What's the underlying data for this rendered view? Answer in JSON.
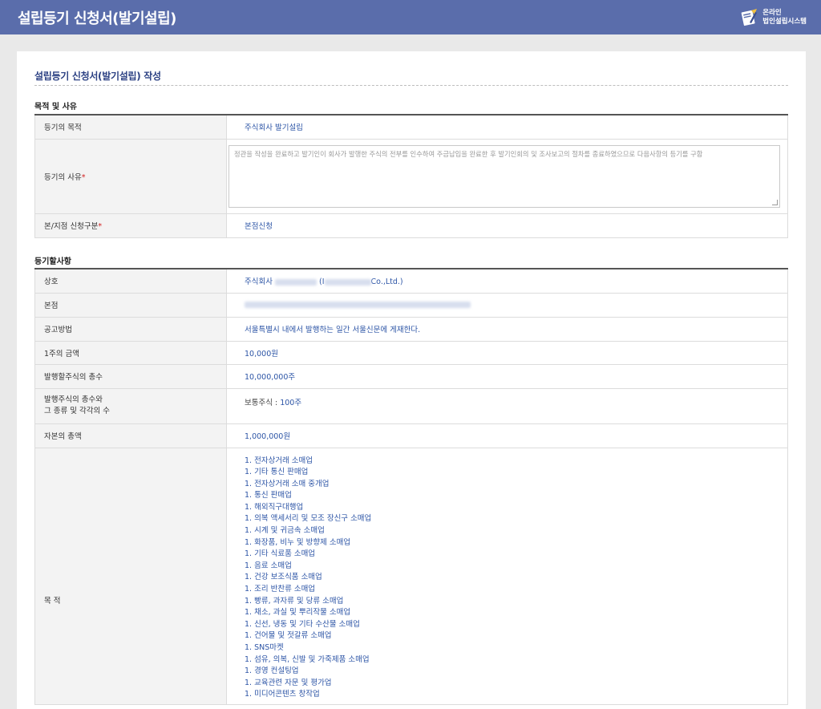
{
  "header": {
    "title": "설립등기 신청서(발기설립)",
    "brand_line1": "온라인",
    "brand_line2": "법인설립시스템"
  },
  "page": {
    "form_title": "설립등기 신청서(발기설립) 작성"
  },
  "section1": {
    "title": "목적 및 사유",
    "rows": {
      "purpose_label": "등기의 목적",
      "purpose_value": "주식회사 발기설립",
      "reason_label": "등기의 사유",
      "reason_value": "정관을 작성을 완료하고 발기인이 회사가 발행한 주식의 전부를 인수하여 주금납입을 완료한 후 발기인회의 및 조사보고의 절차를 종료하였으므로 다음사항의 등기를 구함",
      "branch_label": "본/지점 신청구분",
      "branch_value": "본점신청"
    }
  },
  "section2": {
    "title": "등기할사항",
    "rows": {
      "name_label": "상호",
      "name_prefix": "주식회사",
      "name_paren_open": "(I",
      "name_suffix": "Co.,Ltd.)",
      "hq_label": "본점",
      "notice_label": "공고방법",
      "notice_value": "서울특별시 내에서 발행하는 일간 서울신문에 게재한다.",
      "par_label": "1주의 금액",
      "par_value": "10,000원",
      "authorized_label": "발행할주식의 총수",
      "authorized_value": "10,000,000주",
      "issued_label_line1": "발행주식의 총수와",
      "issued_label_line2": "그 종류 및 각각의 수",
      "issued_value_prefix": "보통주식 : ",
      "issued_value": "100주",
      "capital_label": "자본의 총액",
      "capital_value": "1,000,000원",
      "objects_label": "목 적"
    },
    "objects": [
      "1. 전자상거래 소매업",
      "1. 기타 통신 판매업",
      "1. 전자상거래 소매 중개업",
      "1. 통신 판매업",
      "1. 해외직구대행업",
      "1. 의복 액세서리 및 모조 장신구 소매업",
      "1. 시계 및 귀금속 소매업",
      "1. 화장품, 비누 및 방향제 소매업",
      "1. 기타 식료품 소매업",
      "1. 음료 소매업",
      "1. 건강 보조식품 소매업",
      "1. 조리 반찬류 소매업",
      "1. 빵류, 과자류 및 당류 소매업",
      "1. 채소, 과실 및 뿌리작물 소매업",
      "1. 신선, 냉동 및 기타 수산물 소매업",
      "1. 건어물 및 젓갈류 소매업",
      "1. SNS마켓",
      "1. 섬유, 의복, 신발 및 가죽제품 소매업",
      "1. 경영 컨설팅업",
      "1. 교육관련 자문 및 평가업",
      "1. 미디어콘텐츠 창작업"
    ],
    "colors": {
      "value_text": "#2d55a6",
      "required_mark": "#d32020",
      "header_bar": "#5a6dab"
    }
  }
}
